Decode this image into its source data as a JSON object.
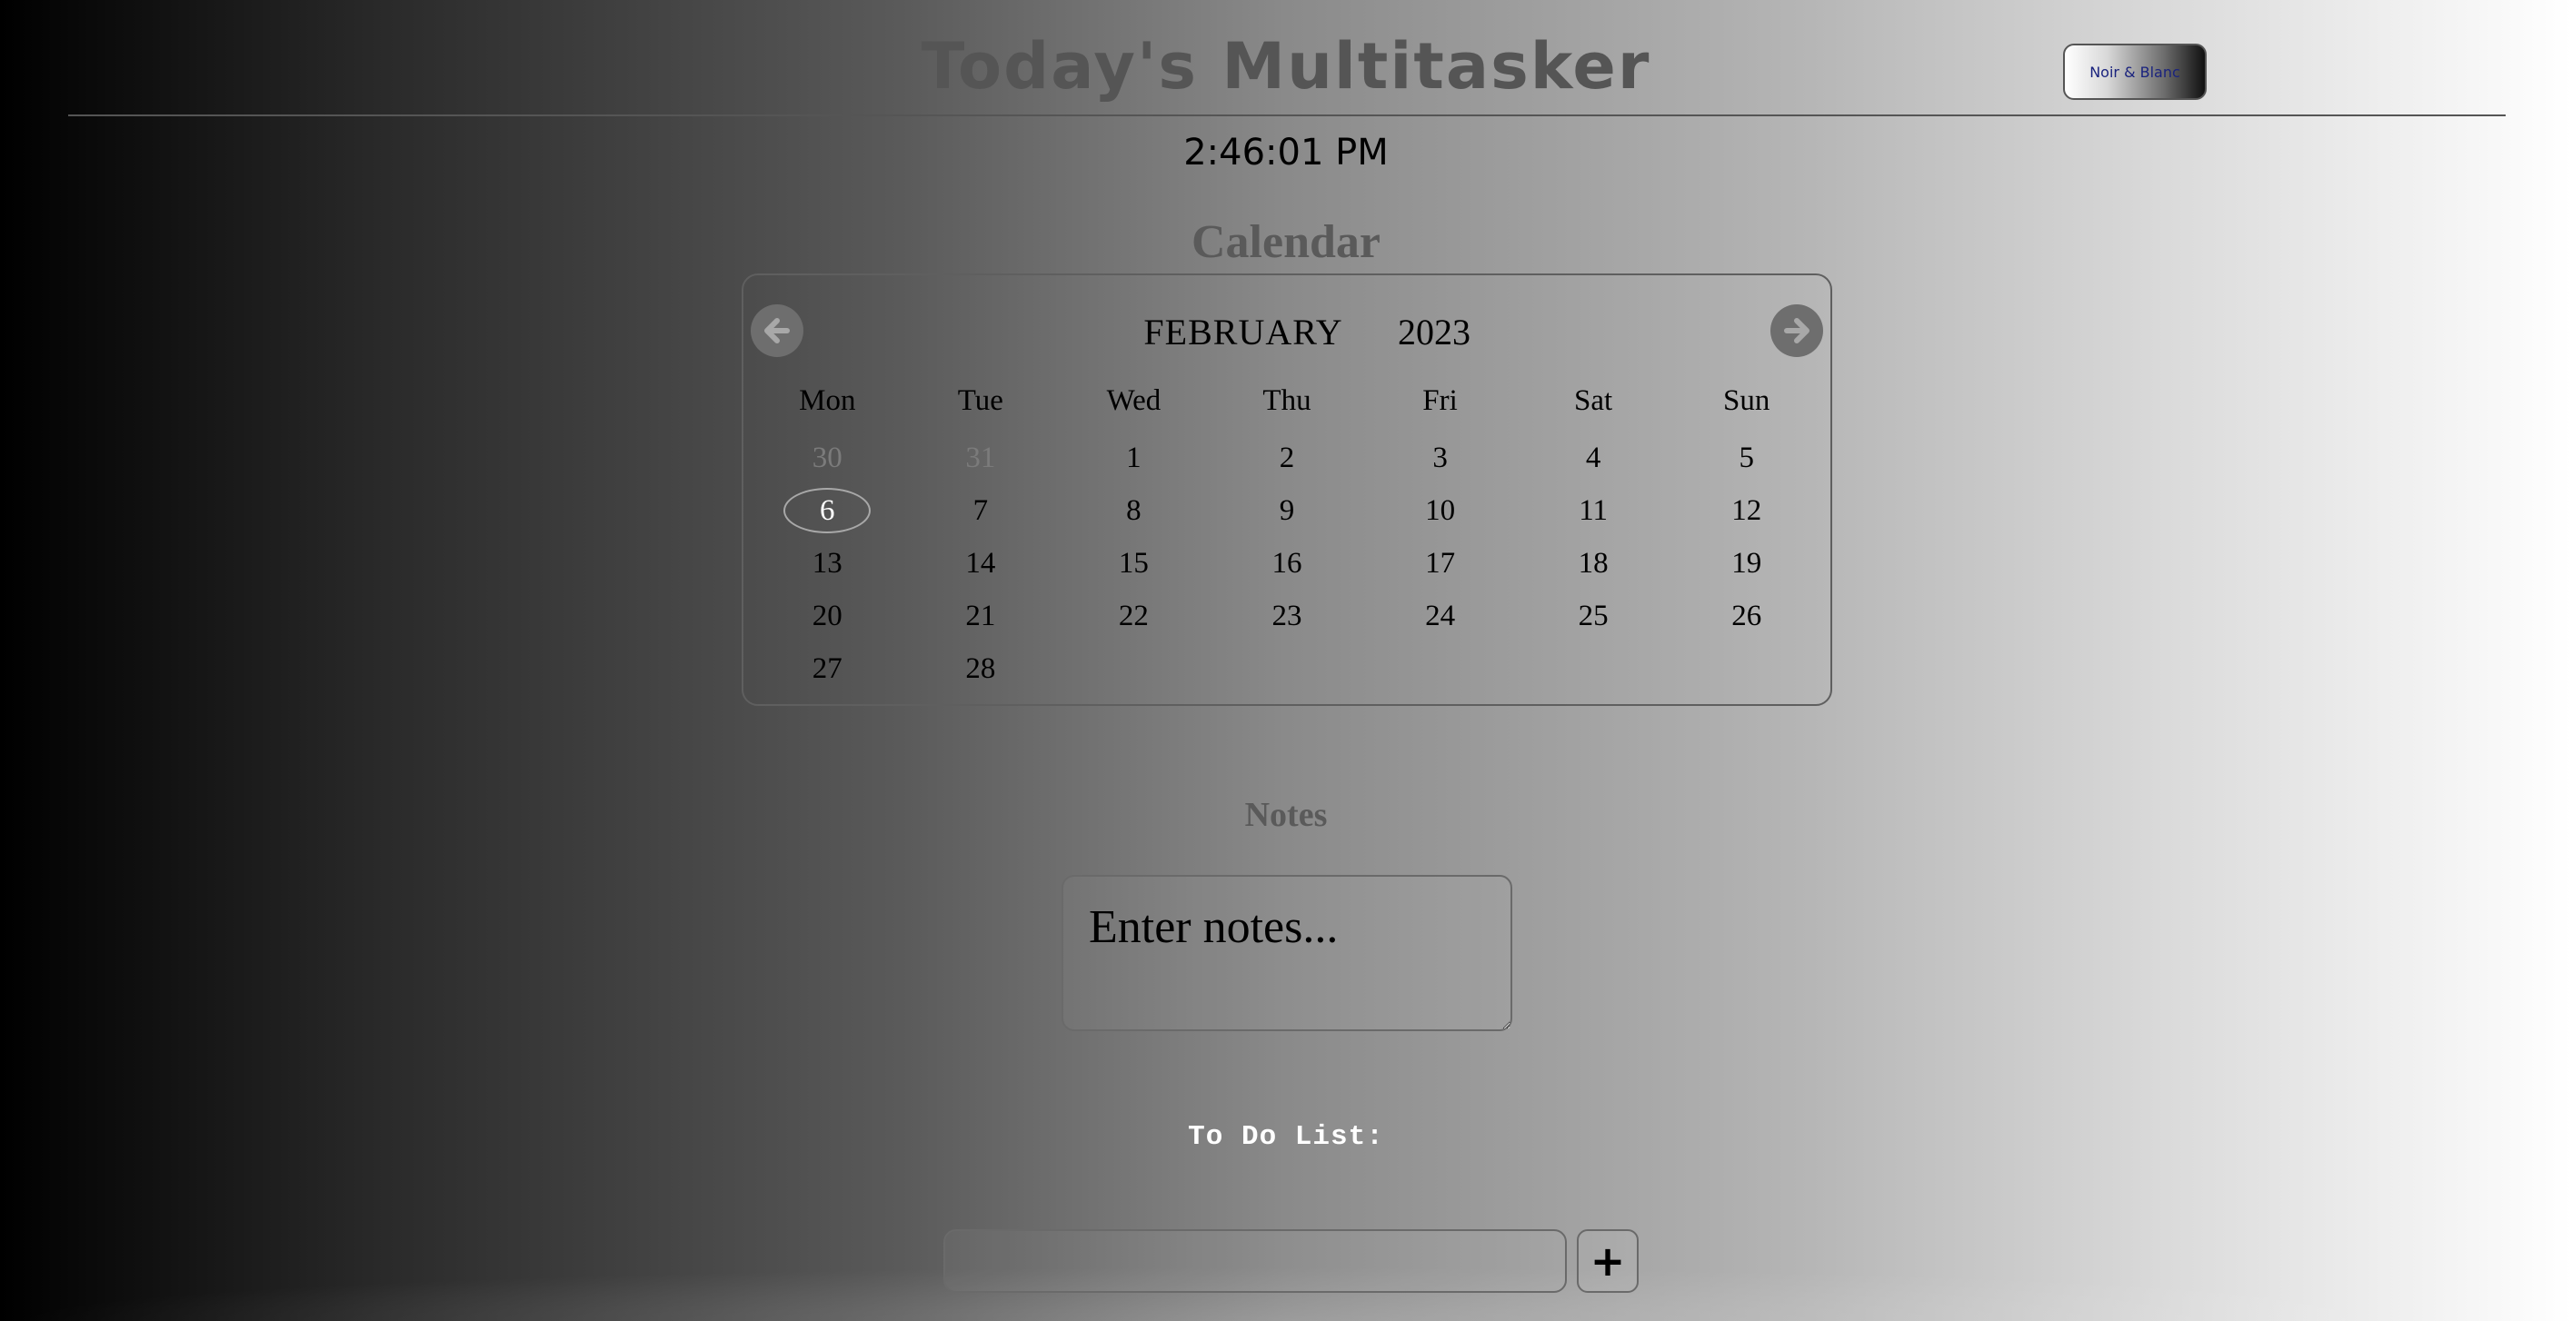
{
  "header": {
    "title": "Today's Multitasker",
    "theme_toggle_label": "Noir & Blanc"
  },
  "clock": {
    "time": "2:46:01 PM"
  },
  "calendar": {
    "heading": "Calendar",
    "month": "FEBRUARY",
    "year": "2023",
    "prev_icon": "arrow-left-circle-icon",
    "next_icon": "arrow-right-circle-icon",
    "weekdays": [
      "Mon",
      "Tue",
      "Wed",
      "Thu",
      "Fri",
      "Sat",
      "Sun"
    ],
    "weeks": [
      [
        "30",
        "31",
        "1",
        "2",
        "3",
        "4",
        "5"
      ],
      [
        "6",
        "7",
        "8",
        "9",
        "10",
        "11",
        "12"
      ],
      [
        "13",
        "14",
        "15",
        "16",
        "17",
        "18",
        "19"
      ],
      [
        "20",
        "21",
        "22",
        "23",
        "24",
        "25",
        "26"
      ],
      [
        "27",
        "28",
        "",
        "",
        "",
        "",
        ""
      ]
    ],
    "muted_days": [
      "30",
      "31"
    ],
    "today": "6"
  },
  "notes": {
    "heading": "Notes",
    "placeholder": "Enter notes..."
  },
  "todo": {
    "heading": "To Do List:",
    "input_placeholder": "",
    "add_label": "+"
  },
  "colors": {
    "heading_gray": "#5a5a5a",
    "theme_toggle_text": "#1a237e",
    "nav_button": "#6e6e6e"
  }
}
